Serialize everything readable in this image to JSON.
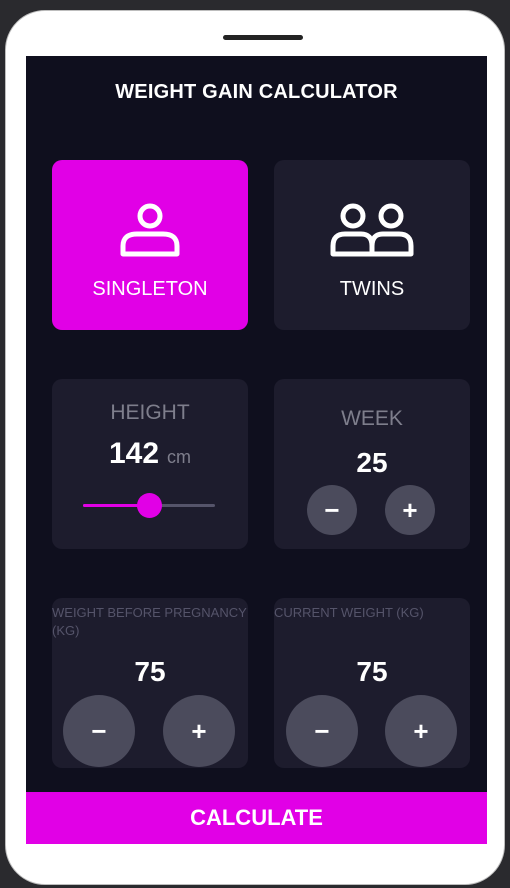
{
  "app": {
    "title": "WEIGHT GAIN CALCULATOR",
    "accent": "#e100e6",
    "card_color": "#1d1c2d",
    "background": "#0f0f1e"
  },
  "pregnancy_type": {
    "options": [
      {
        "label": "SINGLETON",
        "icon": "person-icon",
        "selected": true
      },
      {
        "label": "TWINS",
        "icon": "two-persons-icon",
        "selected": false
      }
    ]
  },
  "height": {
    "label": "HEIGHT",
    "value": "142",
    "unit": "cm",
    "slider_fraction": 0.5
  },
  "week": {
    "label": "WEEK",
    "value": "25",
    "minus": "−",
    "plus": "+"
  },
  "weight_before": {
    "label": "WEIGHT BEFORE PREGNANCY (KG)",
    "value": "75",
    "minus": "−",
    "plus": "+"
  },
  "current_weight": {
    "label": "CURRENT WEIGHT (KG)",
    "value": "75",
    "minus": "−",
    "plus": "+"
  },
  "calculate": {
    "label": "CALCULATE"
  }
}
